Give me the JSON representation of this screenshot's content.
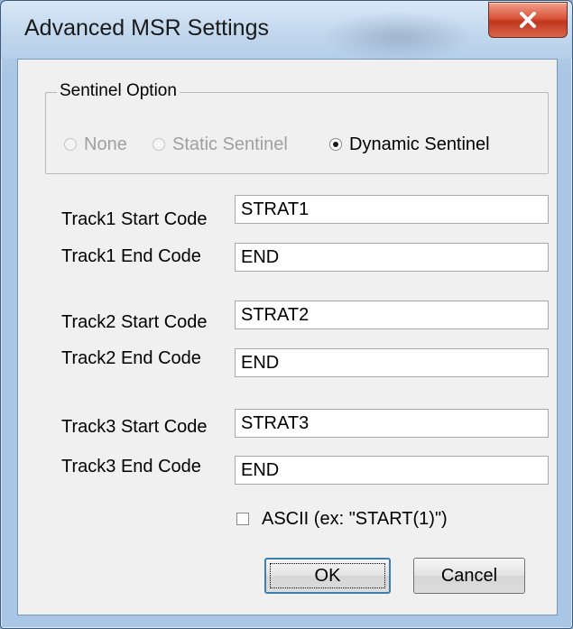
{
  "window": {
    "title": "Advanced MSR Settings",
    "close_label": "×"
  },
  "sentinel": {
    "legend": "Sentinel Option",
    "options": [
      {
        "label": "None",
        "selected": false,
        "enabled": false
      },
      {
        "label": "Static Sentinel",
        "selected": false,
        "enabled": false
      },
      {
        "label": "Dynamic Sentinel",
        "selected": true,
        "enabled": true
      }
    ]
  },
  "tracks": [
    {
      "start_label": "Track1 Start Code",
      "start_value": "STRAT1",
      "end_label": "Track1 End Code",
      "end_value": "END"
    },
    {
      "start_label": "Track2 Start Code",
      "start_value": "STRAT2",
      "end_label": "Track2 End Code",
      "end_value": "END"
    },
    {
      "start_label": "Track3 Start Code",
      "start_value": "STRAT3",
      "end_label": "Track3 End Code",
      "end_value": "END"
    }
  ],
  "ascii_checkbox": {
    "label": "ASCII (ex: \"START(1)\")",
    "checked": false
  },
  "buttons": {
    "ok": "OK",
    "cancel": "Cancel"
  },
  "colors": {
    "titlebar": "#c2d8ee",
    "close_button": "#c0361e",
    "dialog_bg": "#f0f0f0",
    "default_button_border": "#3c7fb1"
  }
}
